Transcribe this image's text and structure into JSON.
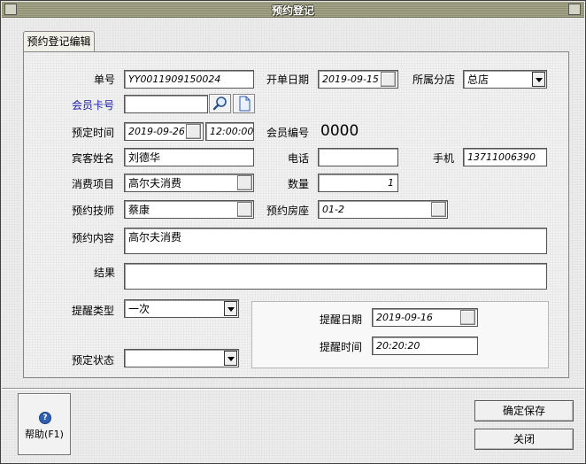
{
  "window": {
    "title": "预约登记"
  },
  "tab": {
    "label": "预约登记编辑"
  },
  "labels": {
    "order_no": "单号",
    "open_date": "开单日期",
    "branch": "所属分店",
    "member_card": "会员卡号",
    "reserve_time": "预定时间",
    "member_no": "会员编号",
    "guest_name": "宾客姓名",
    "phone": "电话",
    "mobile": "手机",
    "item": "消费项目",
    "quantity": "数量",
    "technician": "预约技师",
    "room": "预约房座",
    "content": "预约内容",
    "result": "结果",
    "remind_type": "提醒类型",
    "status": "预定状态",
    "remind_date": "提醒日期",
    "remind_time": "提醒时间"
  },
  "values": {
    "order_no": "YY0011909150024",
    "open_date": "2019-09-15",
    "branch": "总店",
    "member_card": "",
    "reserve_date": "2019-09-26",
    "reserve_clock": "12:00:00",
    "member_no": "0000",
    "guest_name": "刘德华",
    "phone": "",
    "mobile": "13711006390",
    "item": "高尔夫消费",
    "quantity": "1",
    "technician": "蔡康",
    "room": "01-2",
    "content": "高尔夫消费",
    "result": "",
    "remind_type": "一次",
    "status": "",
    "remind_date": "2019-09-16",
    "remind_time": "20:20:20"
  },
  "buttons": {
    "help": "帮助(F1)",
    "help_icon_glyph": "?",
    "save": "确定保存",
    "close": "关闭"
  },
  "icons": {
    "search": "magnifier-icon",
    "new_card": "document-icon",
    "help": "help-icon"
  },
  "colors": {
    "title_bar": "#9a9a7e",
    "link_label": "#1a1aa6"
  }
}
